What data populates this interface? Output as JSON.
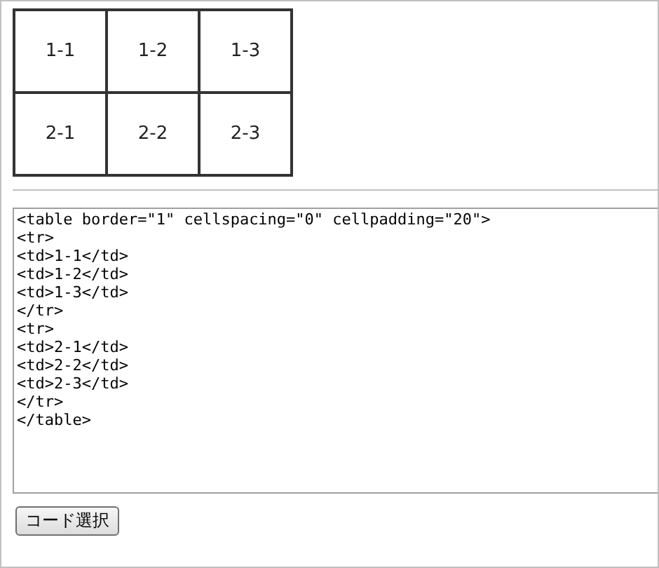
{
  "table": {
    "rows": [
      [
        "1-1",
        "1-2",
        "1-3"
      ],
      [
        "2-1",
        "2-2",
        "2-3"
      ]
    ]
  },
  "code_box": {
    "value": "<table border=\"1\" cellspacing=\"0\" cellpadding=\"20\">\n<tr>\n<td>1-1</td>\n<td>1-2</td>\n<td>1-3</td>\n</tr>\n<tr>\n<td>2-1</td>\n<td>2-2</td>\n<td>2-3</td>\n</tr>\n</table>"
  },
  "select_button": {
    "label": "コード選択"
  }
}
